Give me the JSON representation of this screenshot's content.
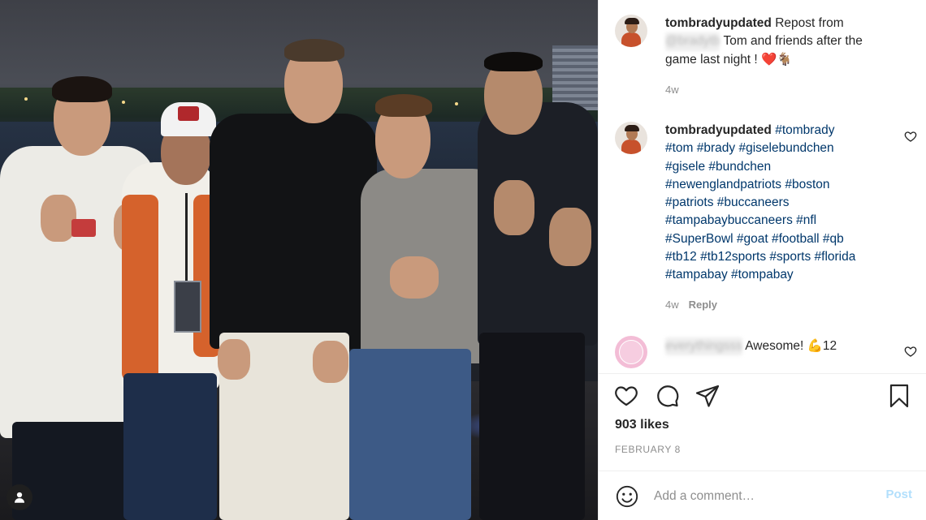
{
  "post": {
    "author": "tombradyupdated",
    "caption": {
      "prefix": "Repost from",
      "blurred_handle": "@bradytb",
      "line1_rest": "Tom and friends after the",
      "line2": "game last night ! ❤️🐐",
      "age": "4w"
    },
    "hashtag_comment": {
      "author": "tombradyupdated",
      "lines": [
        "#tombrady",
        "#tom #brady #giselebundchen",
        "#gisele #bundchen",
        "#newenglandpatriots #boston",
        "#patriots #buccaneers",
        "#tampabaybuccaneers #nfl",
        "#SuperBowl #goat #football #qb",
        "#tb12 #tb12sports #sports #florida",
        "#tampabay #tompabay"
      ],
      "age": "4w",
      "reply_label": "Reply"
    },
    "reply_comment": {
      "blurred_author": "everythingsss",
      "text": "Awesome! 💪12"
    },
    "likes": "903 likes",
    "date": "FEBRUARY 8",
    "add_comment": {
      "placeholder": "Add a comment…",
      "post_label": "Post"
    },
    "icons": {
      "like": "heart-icon",
      "comment": "comment-icon",
      "share": "share-icon",
      "save": "bookmark-icon",
      "emoji": "emoji-icon",
      "tagged": "user-tag-icon"
    },
    "colors": {
      "text": "#262626",
      "muted": "#8e8e8e",
      "hashtag": "#00376b",
      "post_button_disabled": "#b2dffc"
    }
  }
}
